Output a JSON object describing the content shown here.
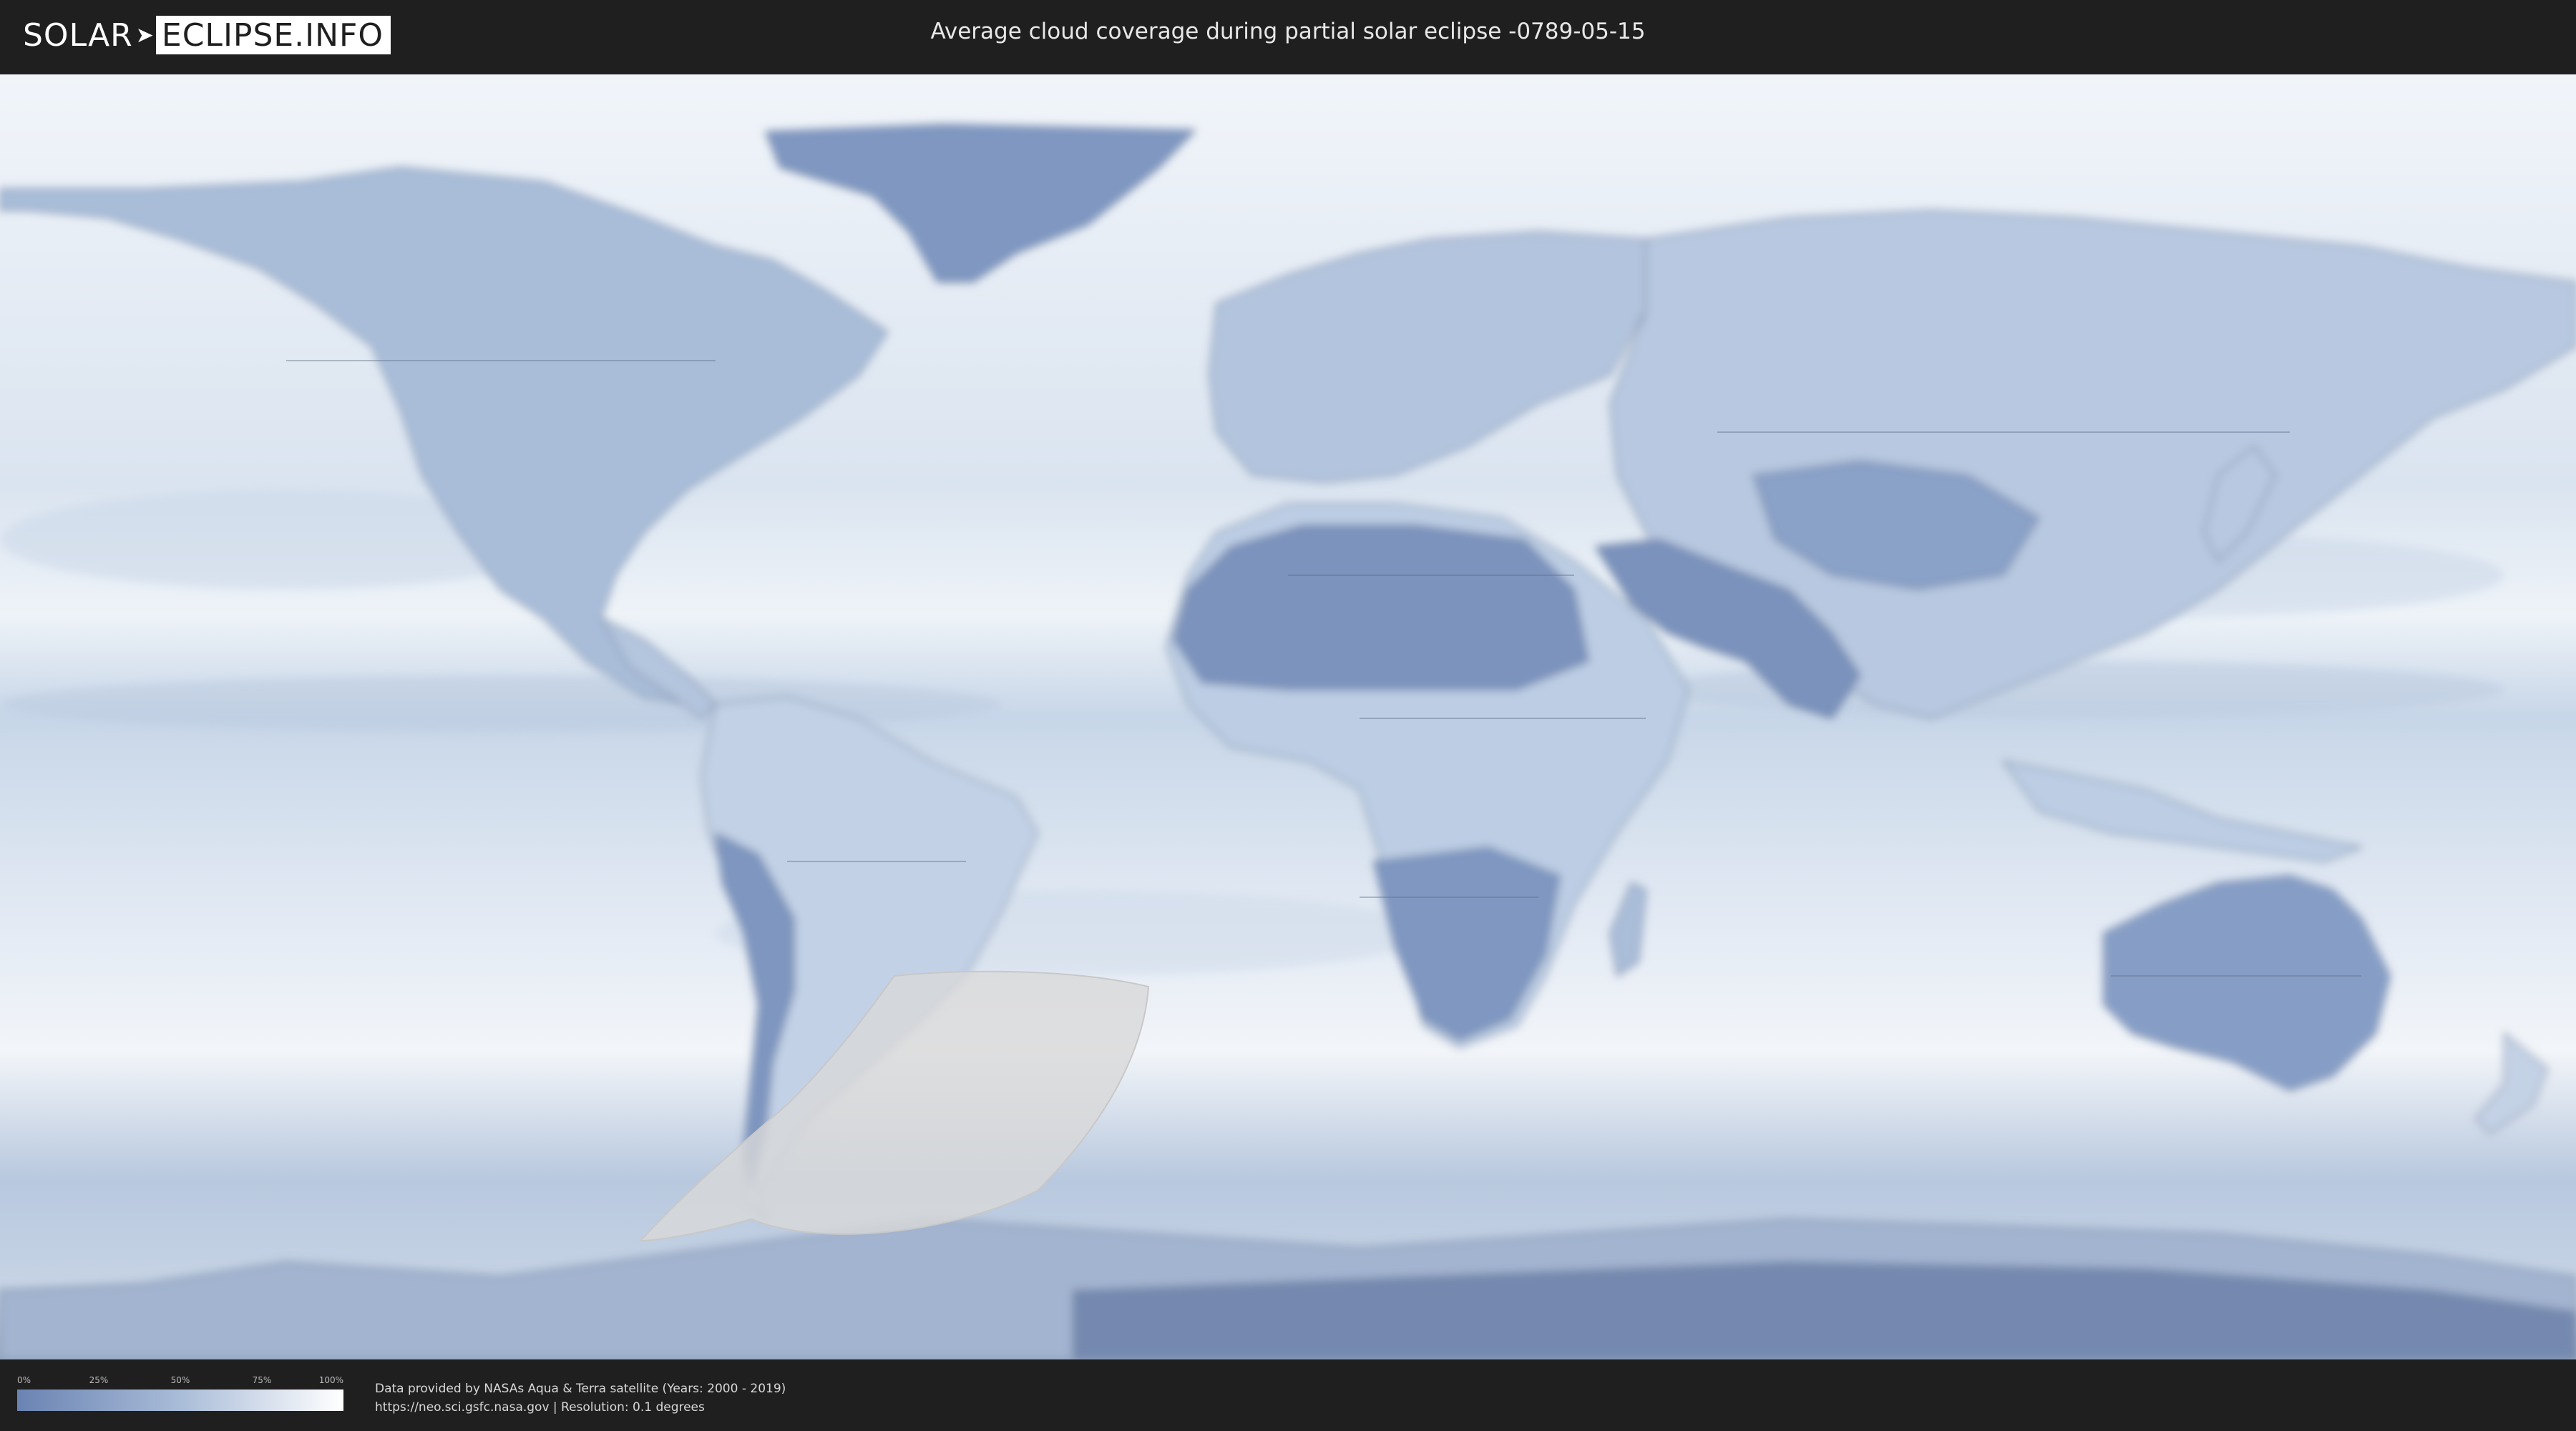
{
  "header": {
    "logo": {
      "left": "SOLAR",
      "right": "ECLIPSE.INFO"
    },
    "title": "Average cloud coverage during partial solar eclipse -0789-05-15"
  },
  "map": {
    "description_colors": {
      "ocean_cloud": "#e6edf6",
      "land_clear": "#7d95bf",
      "eclipse_zone": "#d8d8d8",
      "border": "#5e6e87"
    }
  },
  "legend": {
    "ticks": [
      "0%",
      "25%",
      "50%",
      "75%",
      "100%"
    ],
    "gradient_colors": [
      "#6a83b2",
      "#a9bcd8",
      "#ffffff"
    ]
  },
  "credits": {
    "line1": "Data provided by NASAs Aqua & Terra satellite (Years: 2000 - 2019)",
    "line2": "https://neo.sci.gsfc.nasa.gov | Resolution: 0.1 degrees"
  }
}
